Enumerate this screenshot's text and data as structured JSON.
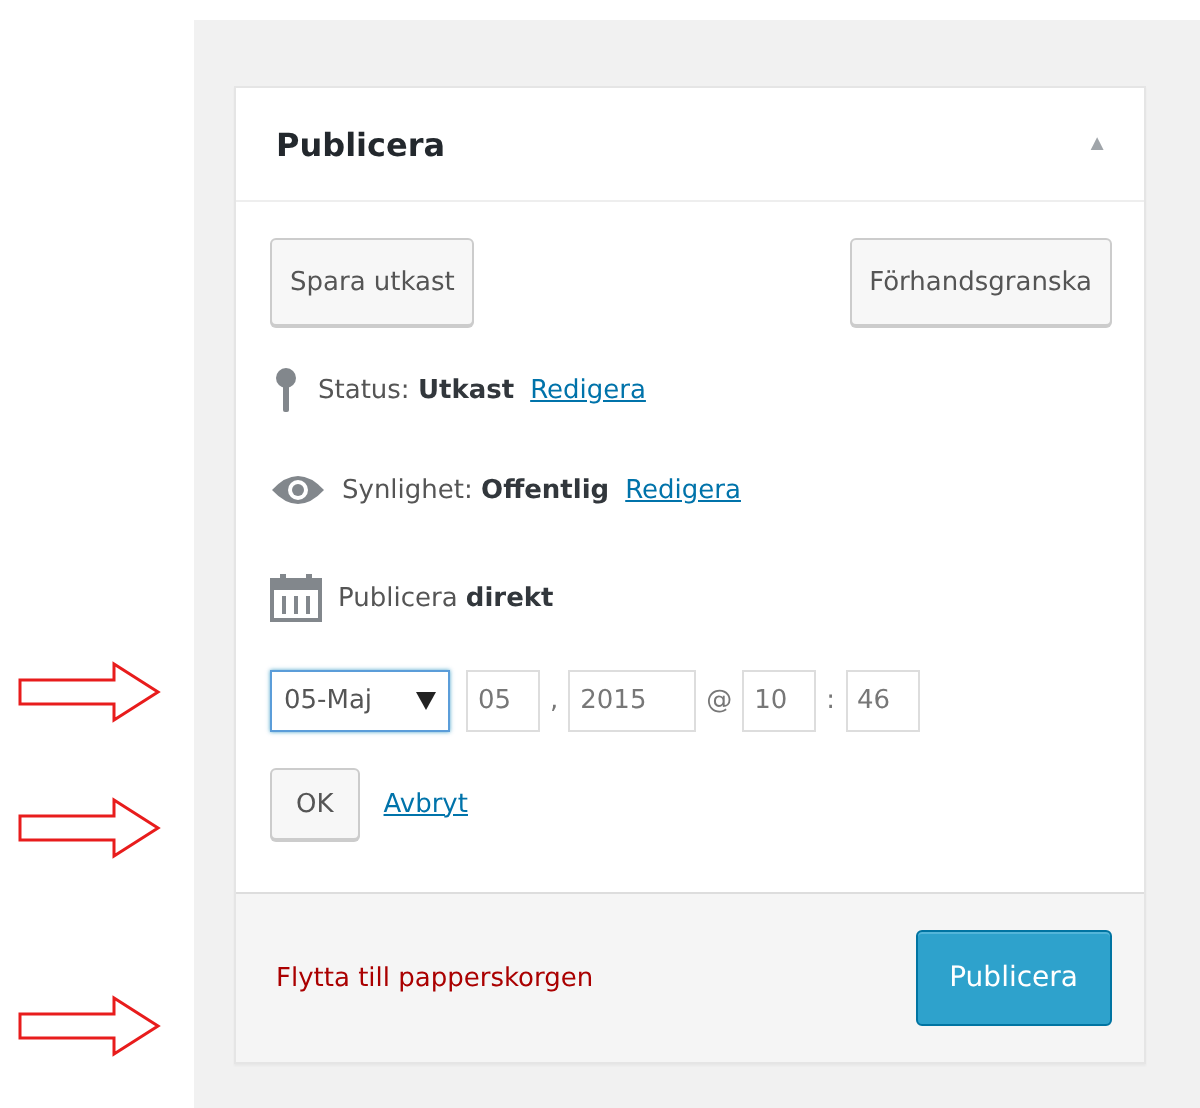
{
  "panel": {
    "title": "Publicera",
    "collapse_glyph": "▲"
  },
  "buttons": [
    {
      "label": "Spara utkast"
    },
    {
      "label": "Förhandsgranska"
    }
  ],
  "info_rows": [
    {
      "kind": "status",
      "text": "Status: **Utkast**",
      "link": "Redigera"
    },
    {
      "kind": "visibility",
      "text": "Synlighet: **Offentlig**",
      "link": "Redigera"
    },
    {
      "kind": "schedule",
      "text": "Publicera **direkt**"
    }
  ],
  "date": {
    "month": "05-Maj",
    "day": "05",
    "year": "2015",
    "hour": "10",
    "minute": "46",
    "sep_comma": ",",
    "sep_at": "@",
    "sep_colon": ":"
  },
  "date_actions": {
    "ok": "OK",
    "cancel": "Avbryt"
  },
  "footer": {
    "trash_link": "Flytta till papperskorgen",
    "publish_button": "Publicera"
  },
  "annotations": [
    {
      "kind": "arrow"
    },
    {
      "kind": "arrow"
    },
    {
      "kind": "arrow"
    }
  ]
}
